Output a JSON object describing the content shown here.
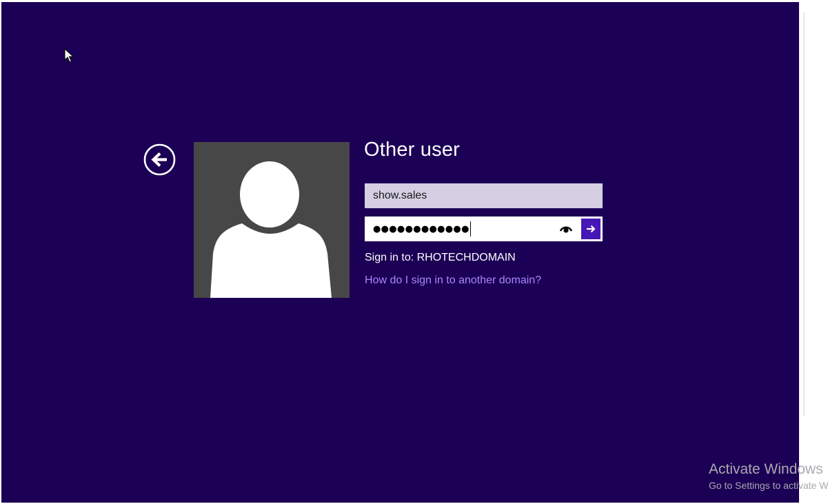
{
  "logon": {
    "title": "Other user",
    "username_value": "show.sales",
    "password_masked": "●●●●●●●●●●●●",
    "signin_to": "Sign in to: RHOTECHDOMAIN",
    "domain_help_link": "How do I sign in to another domain?"
  },
  "icons": {
    "back": "back-arrow-circle-icon",
    "reveal": "eye-reveal-password-icon",
    "submit": "right-arrow-icon",
    "avatar": "user-silhouette-icon",
    "cursor": "mouse-pointer-icon"
  },
  "watermark": {
    "title": "Activate Windows",
    "subtitle": "Go to Settings to activate Windows."
  },
  "colors": {
    "background": "#1c0055",
    "accent": "#4617b4",
    "link": "#a887ff",
    "avatar_bg": "#474747",
    "username_bg": "#d4cfe3"
  }
}
